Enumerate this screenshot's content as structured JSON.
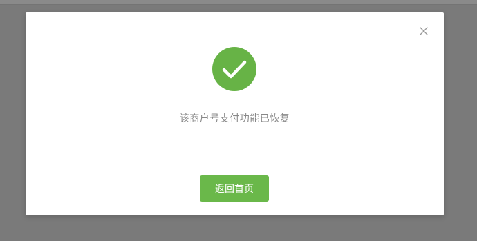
{
  "dialog": {
    "message": "该商户号支付功能已恢复",
    "return_label": "返回首页",
    "close_icon": "close-icon",
    "status_icon": "checkmark-icon"
  },
  "colors": {
    "accent_green": "#67b346",
    "button_green": "#6ab84a",
    "overlay": "#7a7a7a",
    "message_text": "#888888",
    "close_icon": "#999999"
  }
}
